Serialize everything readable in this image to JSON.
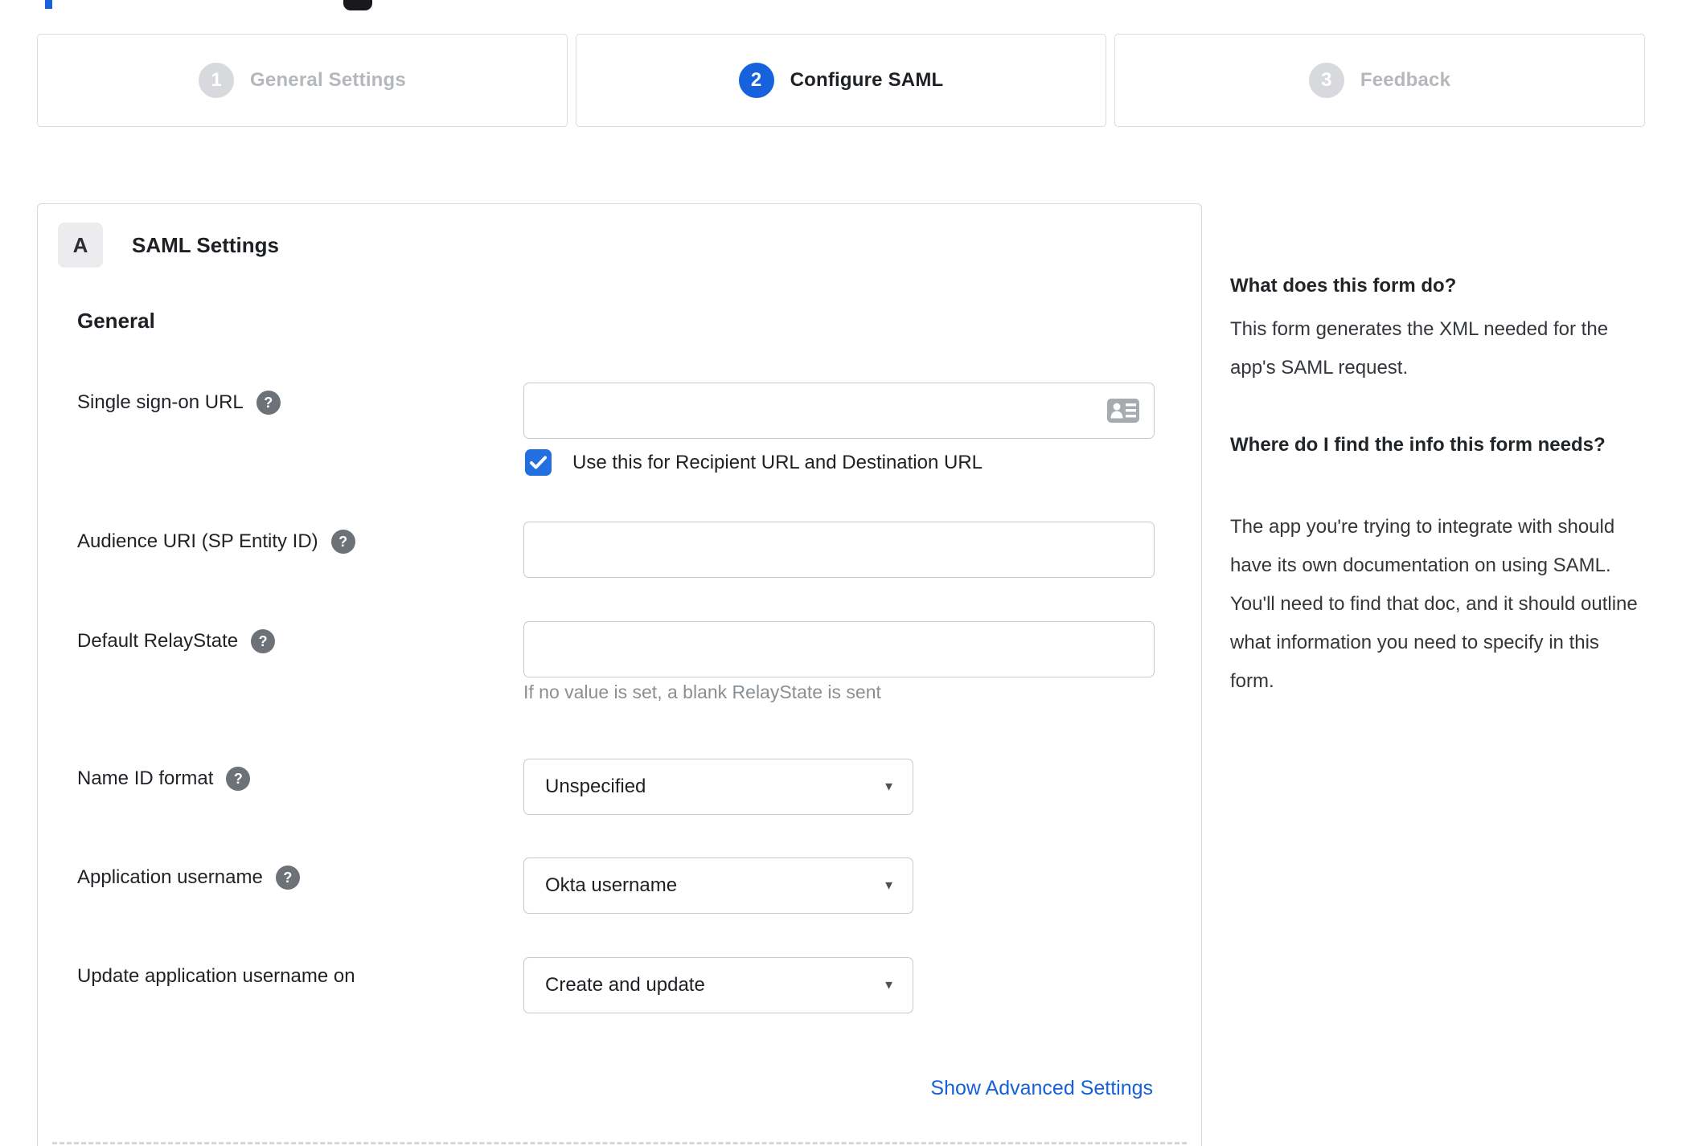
{
  "colors": {
    "accent_blue": "#1662dd",
    "checkbox_blue": "#2270e0",
    "link_blue": "#1761d8",
    "inactive_gray": "#b4b7bc",
    "hint_gray": "#8a8f94"
  },
  "icons": {
    "help_glyph": "?",
    "caret_glyph": "▼",
    "help": "help-icon",
    "contact_card": "contact-card-icon",
    "checkbox_check": "checkmark-icon"
  },
  "stepper": {
    "steps": [
      {
        "number": "1",
        "label": "General Settings",
        "active": false
      },
      {
        "number": "2",
        "label": "Configure SAML",
        "active": true
      },
      {
        "number": "3",
        "label": "Feedback",
        "active": false
      }
    ]
  },
  "panel": {
    "badge_letter": "A",
    "title": "SAML Settings",
    "section_heading": "General",
    "advanced_link": "Show Advanced Settings"
  },
  "form": {
    "rows": [
      {
        "label": "Single sign-on URL",
        "has_help": true,
        "control": "text-input",
        "value": "",
        "checkbox_checked": true,
        "checkbox_label": "Use this for Recipient URL and Destination URL"
      },
      {
        "label": "Audience URI (SP Entity ID)",
        "has_help": true,
        "control": "text-input",
        "value": ""
      },
      {
        "label": "Default RelayState",
        "has_help": true,
        "control": "text-input",
        "value": "",
        "hint": "If no value is set, a blank RelayState is sent"
      },
      {
        "label": "Name ID format",
        "has_help": true,
        "control": "select",
        "value": "Unspecified"
      },
      {
        "label": "Application username",
        "has_help": true,
        "control": "select",
        "value": "Okta username"
      },
      {
        "label": "Update application username on",
        "has_help": false,
        "control": "select",
        "value": "Create and update"
      }
    ]
  },
  "sidebar": {
    "sections": [
      {
        "heading": "What does this form do?",
        "body": "This form generates the XML needed for the app's SAML request."
      },
      {
        "heading": "Where do I find the info this form needs?",
        "body": "The app you're trying to integrate with should have its own documentation on using SAML. You'll need to find that doc, and it should outline what information you need to specify in this form."
      }
    ]
  }
}
